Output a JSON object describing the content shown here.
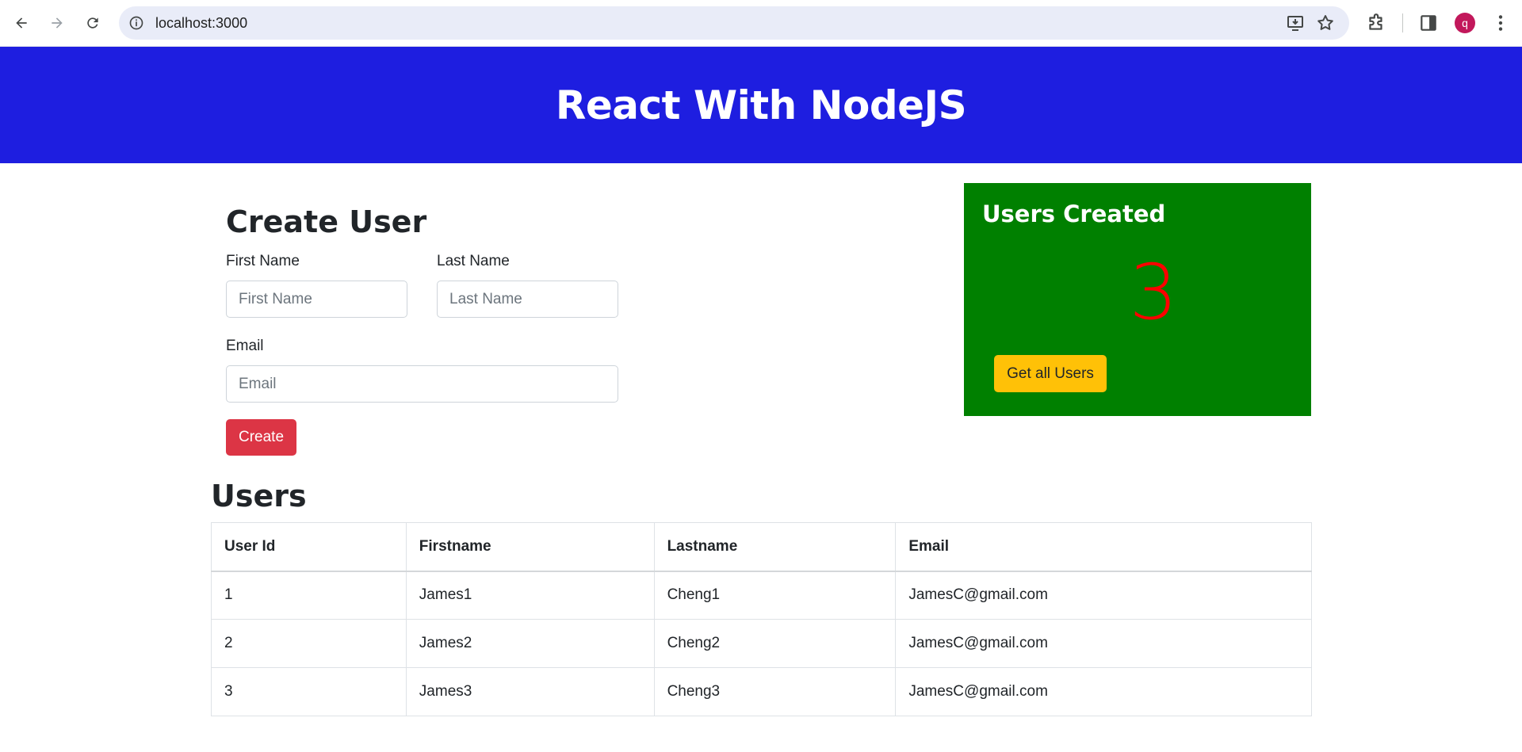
{
  "browser": {
    "url": "localhost:3000",
    "avatar_letter": "q"
  },
  "header": {
    "title": "React With NodeJS",
    "background": "#1e1ee0"
  },
  "create_form": {
    "title": "Create User",
    "first_name_label": "First Name",
    "first_name_placeholder": "First Name",
    "last_name_label": "Last Name",
    "last_name_placeholder": "Last Name",
    "email_label": "Email",
    "email_placeholder": "Email",
    "submit_label": "Create"
  },
  "stats": {
    "title": "Users Created",
    "count": "3",
    "button_label": "Get all Users",
    "background": "#008000"
  },
  "users_table": {
    "title": "Users",
    "columns": [
      "User Id",
      "Firstname",
      "Lastname",
      "Email"
    ],
    "rows": [
      [
        "1",
        "James1",
        "Cheng1",
        "JamesC@gmail.com"
      ],
      [
        "2",
        "James2",
        "Cheng2",
        "JamesC@gmail.com"
      ],
      [
        "3",
        "James3",
        "Cheng3",
        "JamesC@gmail.com"
      ]
    ]
  },
  "icons": [
    "back-icon",
    "forward-icon",
    "reload-icon",
    "site-info-icon",
    "install-app-icon",
    "bookmark-star-icon",
    "extensions-icon",
    "side-panel-icon",
    "profile-avatar",
    "menu-icon"
  ]
}
